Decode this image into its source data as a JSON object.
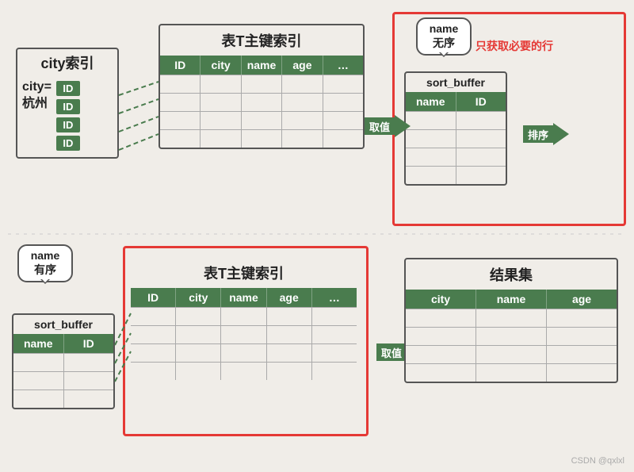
{
  "top": {
    "city_index": {
      "title": "city索引",
      "city_label": "city=\n杭州",
      "ids": [
        "ID",
        "ID",
        "ID",
        "ID"
      ]
    },
    "main_table_top": {
      "title": "表T主键索引",
      "headers": [
        "ID",
        "city",
        "name",
        "age",
        "…"
      ],
      "rows": 4
    },
    "arrow_quzhi": "取值",
    "sort_buffer_top": {
      "label": "sort_buffer",
      "headers": [
        "name",
        "ID"
      ],
      "rows": 4
    },
    "bubble_top": {
      "line1": "name",
      "line2": "无序"
    },
    "annotation_top": "只获取必要的行",
    "arrow_paixu": "排序"
  },
  "bottom": {
    "bubble_bottom": {
      "line1": "name",
      "line2": "有序"
    },
    "sort_buffer_bottom": {
      "label": "sort_buffer",
      "headers": [
        "name",
        "ID"
      ],
      "rows": 3
    },
    "main_table_bottom": {
      "title": "表T主键索引",
      "headers": [
        "ID",
        "city",
        "name",
        "age",
        "…"
      ],
      "rows": 4
    },
    "arrow_quzhi2": "取值",
    "result_set": {
      "title": "结果集",
      "headers": [
        "city",
        "name",
        "age"
      ],
      "rows": 4
    }
  },
  "footer": {
    "label": "CSDN @qxlxl"
  }
}
